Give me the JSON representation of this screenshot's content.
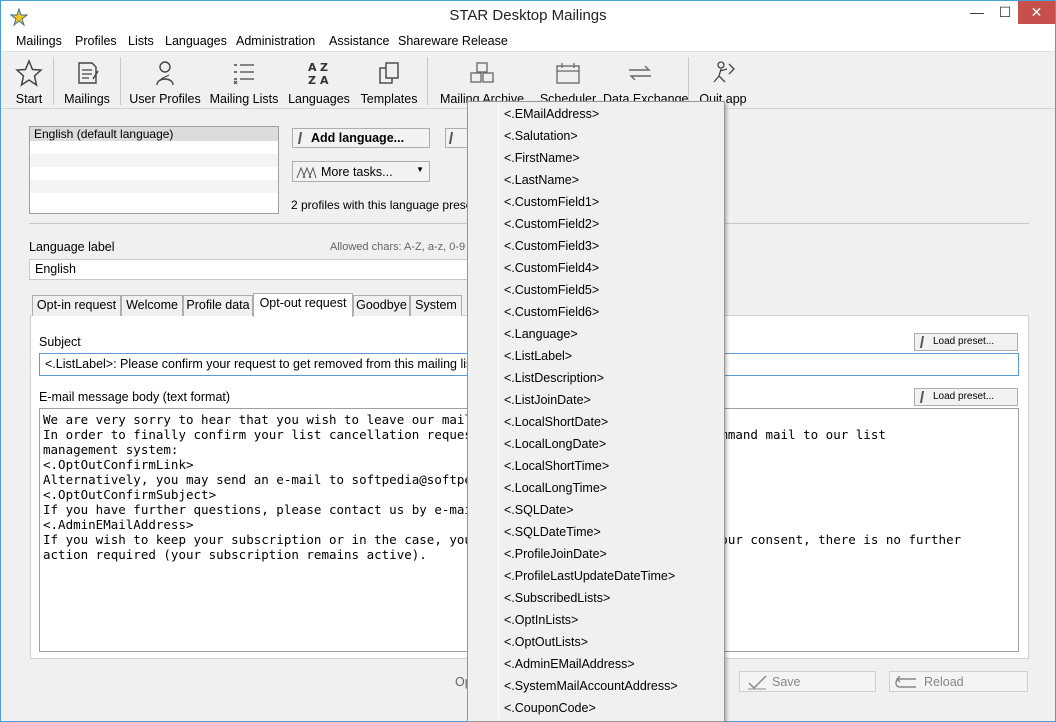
{
  "window": {
    "title": "STAR Desktop Mailings",
    "minimize": "—",
    "maximize": "☐",
    "close": "✕"
  },
  "menubar": [
    "Mailings",
    "Profiles",
    "Lists",
    "Languages",
    "Administration",
    "Assistance",
    "Shareware Release"
  ],
  "toolbar": {
    "start": "Start",
    "mailings": "Mailings",
    "user_profiles": "User Profiles",
    "mailing_lists": "Mailing Lists",
    "languages": "Languages",
    "templates": "Templates",
    "mailing_archive": "Mailing Archive",
    "scheduler": "Scheduler",
    "data_exchange": "Data Exchange",
    "quit": "Quit app"
  },
  "languages_panel": {
    "items": [
      "English (default language)"
    ],
    "add_button": "Add language...",
    "more_tasks_button": "More tasks...",
    "profiles_count_text": "2 profiles with this language prese"
  },
  "language_label": {
    "caption": "Language label",
    "allowed_chars": "Allowed chars: A-Z, a-z, 0-9",
    "value": "English"
  },
  "tabs": [
    "Opt-in request",
    "Welcome",
    "Profile data",
    "Opt-out request",
    "Goodbye",
    "System"
  ],
  "active_tab": "Opt-out request",
  "subject": {
    "caption": "Subject",
    "value": "<.ListLabel>: Please confirm your request to get removed from this mailing list !",
    "preset_button": "Load preset..."
  },
  "body": {
    "caption": "E-mail message body (text format)",
    "preset_button": "Load preset...",
    "lines": [
      "We are very sorry to hear that you wish to leave our mailing",
      "",
      "In order to finally confirm your list cancellation request, p                    send a command mail to our list",
      "management system:",
      "<.OptOutConfirmLink>",
      "",
      "Alternatively, you may send an e-mail to softpedia@softpedia.                    ect line:",
      "<.OptOutConfirmSubject>",
      "",
      "If you have further questions, please contact us by e-mail:",
      "<.AdminEMailAddress>",
      "",
      "If you wish to keep your subscription or in the case, you hav                    without your consent, there is no further",
      "action required (your subscription remains active)."
    ]
  },
  "footer": {
    "partial_text": "Op",
    "save_button": "Save",
    "reload_button": "Reload"
  },
  "placeholder_menu": [
    "<.EMailAddress>",
    "<.Salutation>",
    "<.FirstName>",
    "<.LastName>",
    "<.CustomField1>",
    "<.CustomField2>",
    "<.CustomField3>",
    "<.CustomField4>",
    "<.CustomField5>",
    "<.CustomField6>",
    "<.Language>",
    "<.ListLabel>",
    "<.ListDescription>",
    "<.ListJoinDate>",
    "<.LocalShortDate>",
    "<.LocalLongDate>",
    "<.LocalShortTime>",
    "<.LocalLongTime>",
    "<.SQLDate>",
    "<.SQLDateTime>",
    "<.ProfileJoinDate>",
    "<.ProfileLastUpdateDateTime>",
    "<.SubscribedLists>",
    "<.OptInLists>",
    "<.OptOutLists>",
    "<.AdminEMailAddress>",
    "<.SystemMailAccountAddress>",
    "<.CouponCode>"
  ],
  "colors": {
    "accent": "#4a9fd8",
    "close_button": "#c7504c",
    "focused_input_border": "#5b9bd5"
  }
}
